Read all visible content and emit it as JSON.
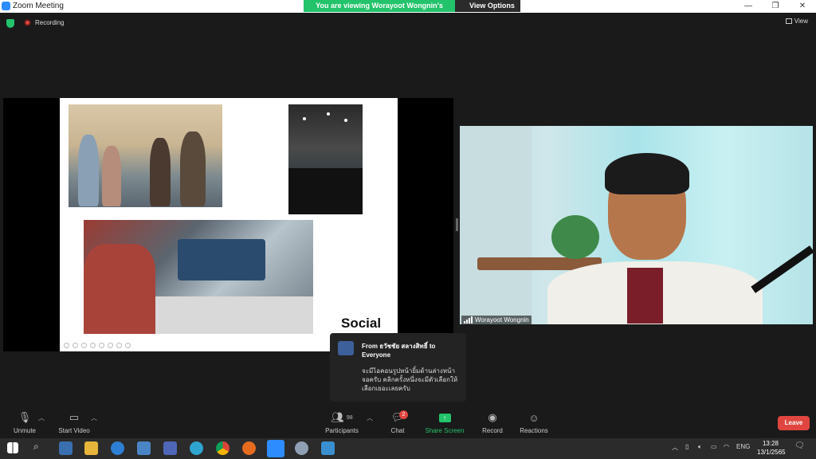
{
  "window": {
    "title": "Zoom Meeting",
    "controls": [
      "—",
      "❐",
      "✕"
    ]
  },
  "banner": {
    "viewing_text": "You are viewing Worayoot Wongnin's screen",
    "view_options_label": "View Options ⌄"
  },
  "status": {
    "recording_label": "Recording",
    "view_label": "View"
  },
  "slide": {
    "caption": "Social"
  },
  "camera": {
    "participant_name": "Worayoot Wongnin"
  },
  "chat_popup": {
    "from_text": "From ธวัชชัย สลางสิทธิ์ to Everyone",
    "message": "จะมีไอคอนรูปหน้ายิ้มด้านล่างหน้าจอครับ คลิกครั้งหนึ่งจะมีตัวเลือกให้เลือกเยอะเลยครับ"
  },
  "toolbar": {
    "unmute_label": "Unmute",
    "start_video_label": "Start Video",
    "participants_label": "Participants",
    "participants_count": "98",
    "chat_label": "Chat",
    "chat_badge": "2",
    "share_screen_label": "Share Screen",
    "record_label": "Record",
    "reactions_label": "Reactions",
    "leave_label": "Leave"
  },
  "taskbar": {
    "language": "ENG",
    "time": "13:28",
    "date": "13/1/2565"
  },
  "colors": {
    "zoom_green": "#23c36b",
    "leave_red": "#e0463f",
    "zoom_blue": "#2d8cff"
  }
}
